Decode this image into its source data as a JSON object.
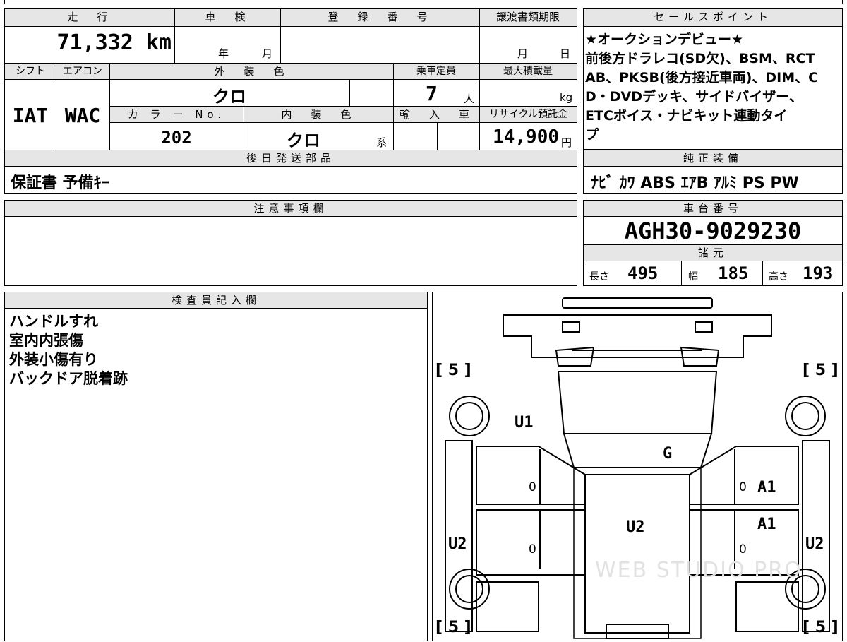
{
  "vehicle": {
    "mileage_label": "走　行",
    "mileage": "71,332 km",
    "shaken_label": "車　検",
    "shaken_year": "年",
    "shaken_month": "月",
    "reg_label": "登　録　番　号",
    "transfer_label": "譲渡書類期限",
    "transfer_month": "月",
    "transfer_day": "日",
    "shift_label": "シフト",
    "shift": "IAT",
    "ac_label": "エアコン",
    "ac": "WAC",
    "exterior_label": "外　装　色",
    "exterior": "クロ",
    "capacity_label": "乗車定員",
    "capacity": "7",
    "capacity_unit": "人",
    "maxload_label": "最大積載量",
    "maxload_unit": "kg",
    "color_no_label": "カ ラ ー No.",
    "color_no": "202",
    "interior_label": "内　装　色",
    "interior": "クロ",
    "interior_suffix": "系",
    "import_label": "輸　入　車",
    "recycle_label": "リサイクル預託金",
    "recycle_amount": "14,900",
    "recycle_unit": "円"
  },
  "later_parts": {
    "title": "後日発送部品",
    "text": "保証書 予備ｷｰ"
  },
  "sales_point": {
    "title": "セールスポイント",
    "lines": [
      "★オークションデビュー★",
      "前後方ドラレコ(SD欠)、BSM、RCT",
      "AB、PKSB(後方接近車両)、DIM、C",
      "D・DVDデッキ、サイドバイザー、",
      "ETCボイス・ナビキット連動タイ",
      "プ"
    ]
  },
  "equipment": {
    "title": "純正装備",
    "text": "ﾅﾋﾞ ｶﾜ ABS ｴｱB ｱﾙﾐ PS PW"
  },
  "notes": {
    "title": "注意事項欄",
    "text": ""
  },
  "chassis": {
    "title": "車台番号",
    "number": "AGH30-9029230",
    "spec_title": "諸元",
    "length_label": "長さ",
    "length": "495",
    "width_label": "幅",
    "width": "185",
    "height_label": "高さ",
    "height": "193"
  },
  "inspector": {
    "title": "検査員記入欄",
    "lines": [
      "ハンドルすれ",
      "室内内張傷",
      "外装小傷有り",
      "バックドア脱着跡"
    ]
  },
  "diagram": {
    "tire_tl": "[ 5 ]",
    "tire_tr": "[ 5 ]",
    "tire_bl": "[ 5 ]",
    "tire_br": "[ 5 ]",
    "marks": {
      "u1": "U1",
      "g": "G",
      "a1_top": "A1",
      "a1_bottom": "A1",
      "u2_center": "U2",
      "u2_left": "U2",
      "u2_right": "U2",
      "zero_l1": "0",
      "zero_l2": "0",
      "zero_r1": "0",
      "zero_r2": "0"
    },
    "watermark": "WEB STUDIO PRO"
  }
}
